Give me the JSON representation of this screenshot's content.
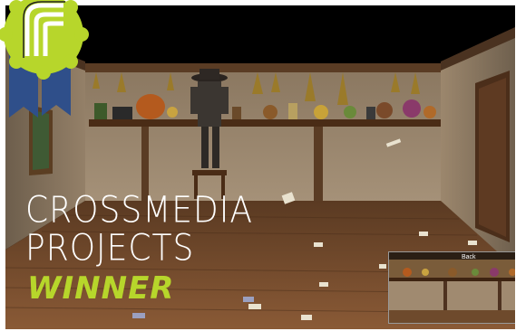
{
  "award": {
    "line1": "CROSSMEDIA",
    "line2": "PROJECTS",
    "line3": "WINNER",
    "accent_color": "#b7d62b",
    "ribbon_color": "#2f4f8a"
  },
  "inset": {
    "label": "Back"
  },
  "scene": {
    "description_icons": [
      "character-silhouette",
      "shelf-with-jars",
      "wooden-door",
      "scattered-papers"
    ]
  }
}
